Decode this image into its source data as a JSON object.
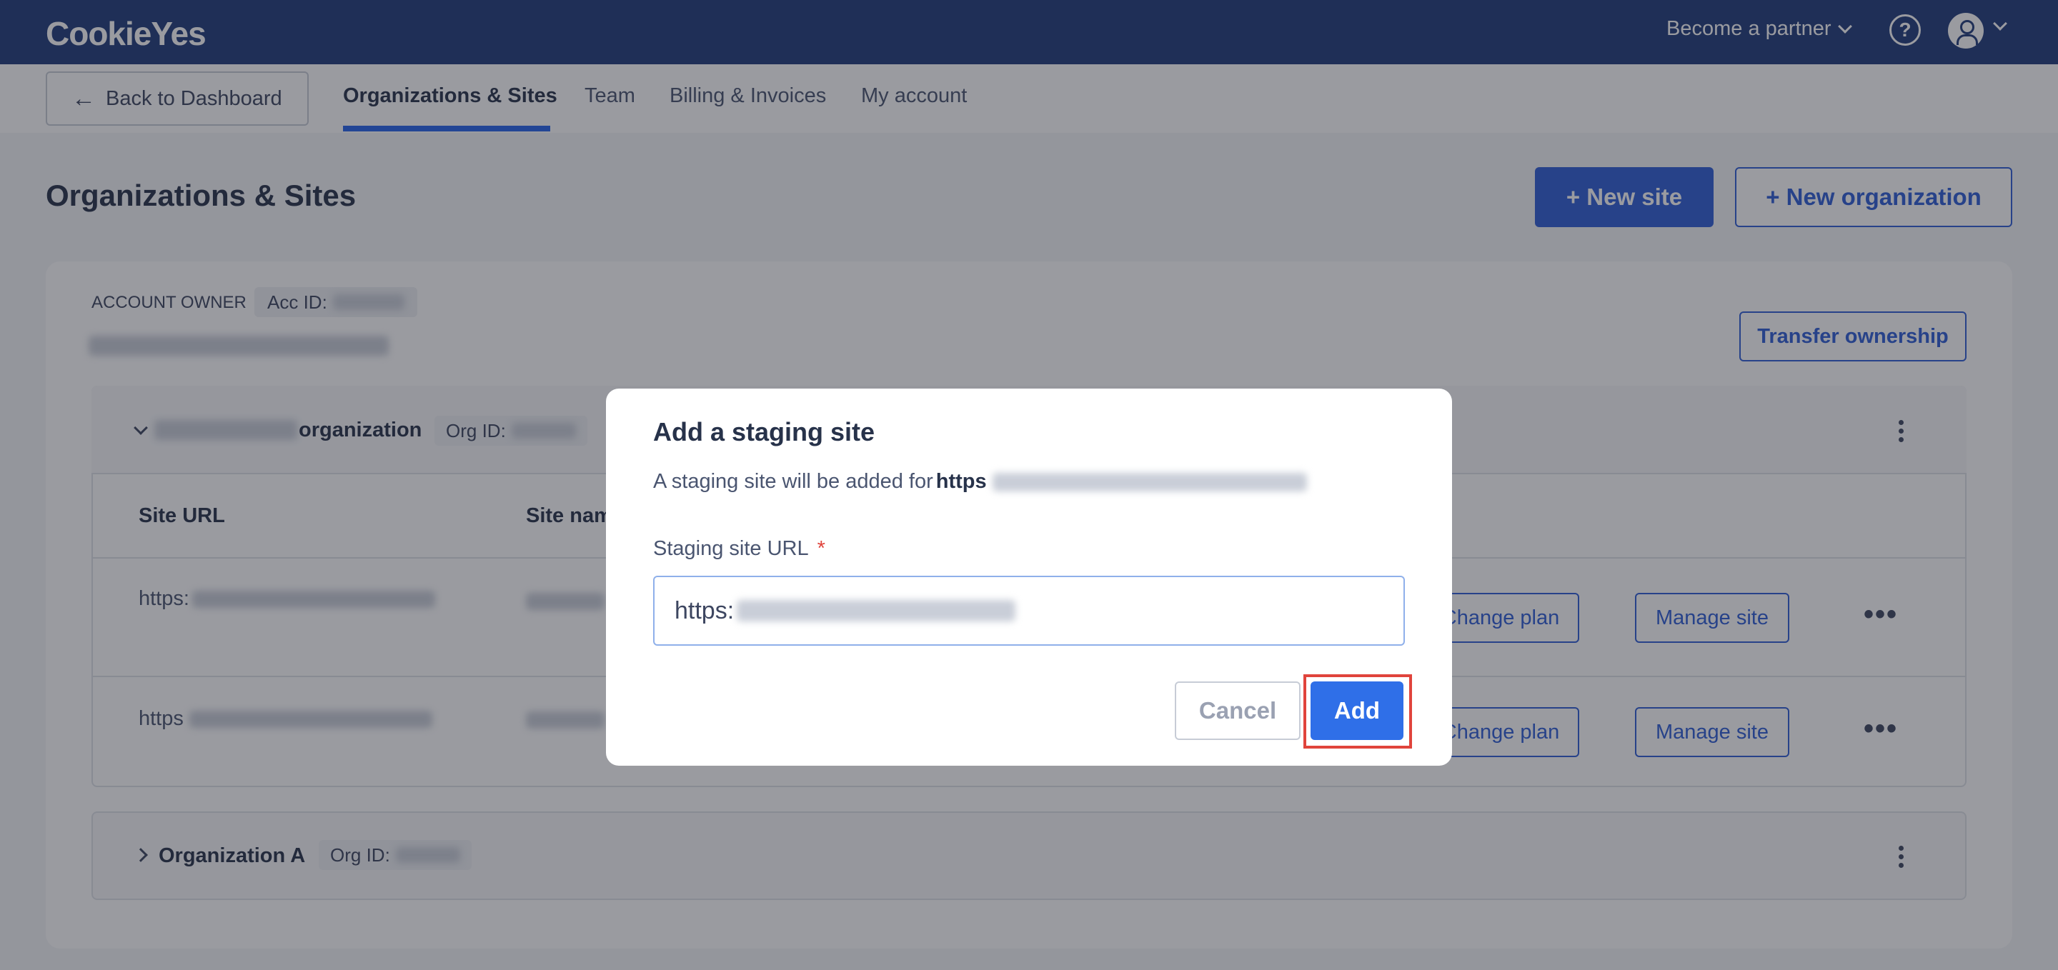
{
  "topbar": {
    "logo": "CookieYes",
    "partner_label": "Become a partner",
    "help_glyph": "?"
  },
  "subnav": {
    "back_label": "Back to Dashboard",
    "tabs": [
      "Organizations & Sites",
      "Team",
      "Billing & Invoices",
      "My account"
    ],
    "active_tab": "Organizations & Sites"
  },
  "page": {
    "title": "Organizations & Sites",
    "new_site_label": "+ New site",
    "new_org_label": "+ New organization"
  },
  "account": {
    "owner_label": "ACCOUNT OWNER",
    "acc_id_label": "Acc ID:",
    "transfer_label": "Transfer ownership"
  },
  "org1": {
    "name_suffix": "organization",
    "org_id_label": "Org ID:",
    "columns": [
      "Site URL",
      "Site nam"
    ],
    "rows": [
      {
        "url_prefix": "https:",
        "change_plan": "Change plan",
        "manage": "Manage site"
      },
      {
        "url_prefix": "https",
        "change_plan": "Change plan",
        "manage": "Manage site"
      }
    ]
  },
  "org2": {
    "name": "Organization A",
    "org_id_label": "Org ID:"
  },
  "modal": {
    "title": "Add a staging site",
    "desc_prefix": "A staging site will be added for",
    "desc_bold": "https",
    "field_label": "Staging site URL",
    "required_mark": "*",
    "input_value": "https:",
    "cancel_label": "Cancel",
    "add_label": "Add"
  },
  "colors": {
    "topbar": "#1f3b7a",
    "primary": "#2f5ed6",
    "add_button": "#2f6fe8",
    "highlight": "#e0443c"
  }
}
